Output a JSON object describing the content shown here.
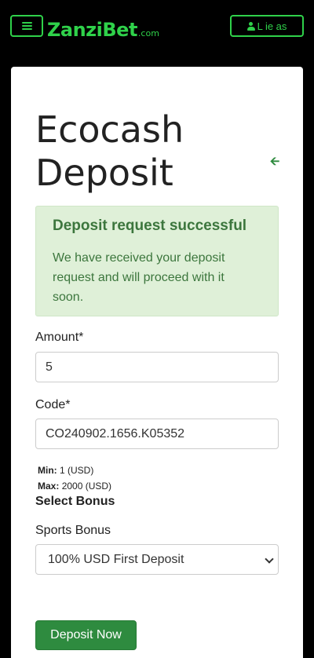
{
  "header": {
    "logo_main": "ZanziBet",
    "logo_suffix": ".com",
    "user_label": "L  ie  as",
    "menu_icon": "hamburger-icon",
    "user_icon": "user-icon"
  },
  "page": {
    "title": "Ecocash Deposit",
    "back_icon": "arrow-left-icon"
  },
  "alert": {
    "title": "Deposit request successful",
    "body": "We have received your deposit request and will proceed with it soon."
  },
  "form": {
    "amount_label": "Amount*",
    "amount_value": "5",
    "code_label": "Code*",
    "code_value": "CO240902.1656.K05352",
    "min_label": "Min:",
    "min_value": "1 (USD)",
    "max_label": "Max:",
    "max_value": "2000 (USD)",
    "bonus_heading": "Select Bonus",
    "bonus_label": "Sports Bonus",
    "bonus_selected": "100% USD First Deposit",
    "submit_label": "Deposit Now"
  },
  "colors": {
    "brand_green": "#2fd14a",
    "button_green": "#2e8b3f",
    "alert_bg": "#dff0d8",
    "alert_text": "#3c763d"
  }
}
